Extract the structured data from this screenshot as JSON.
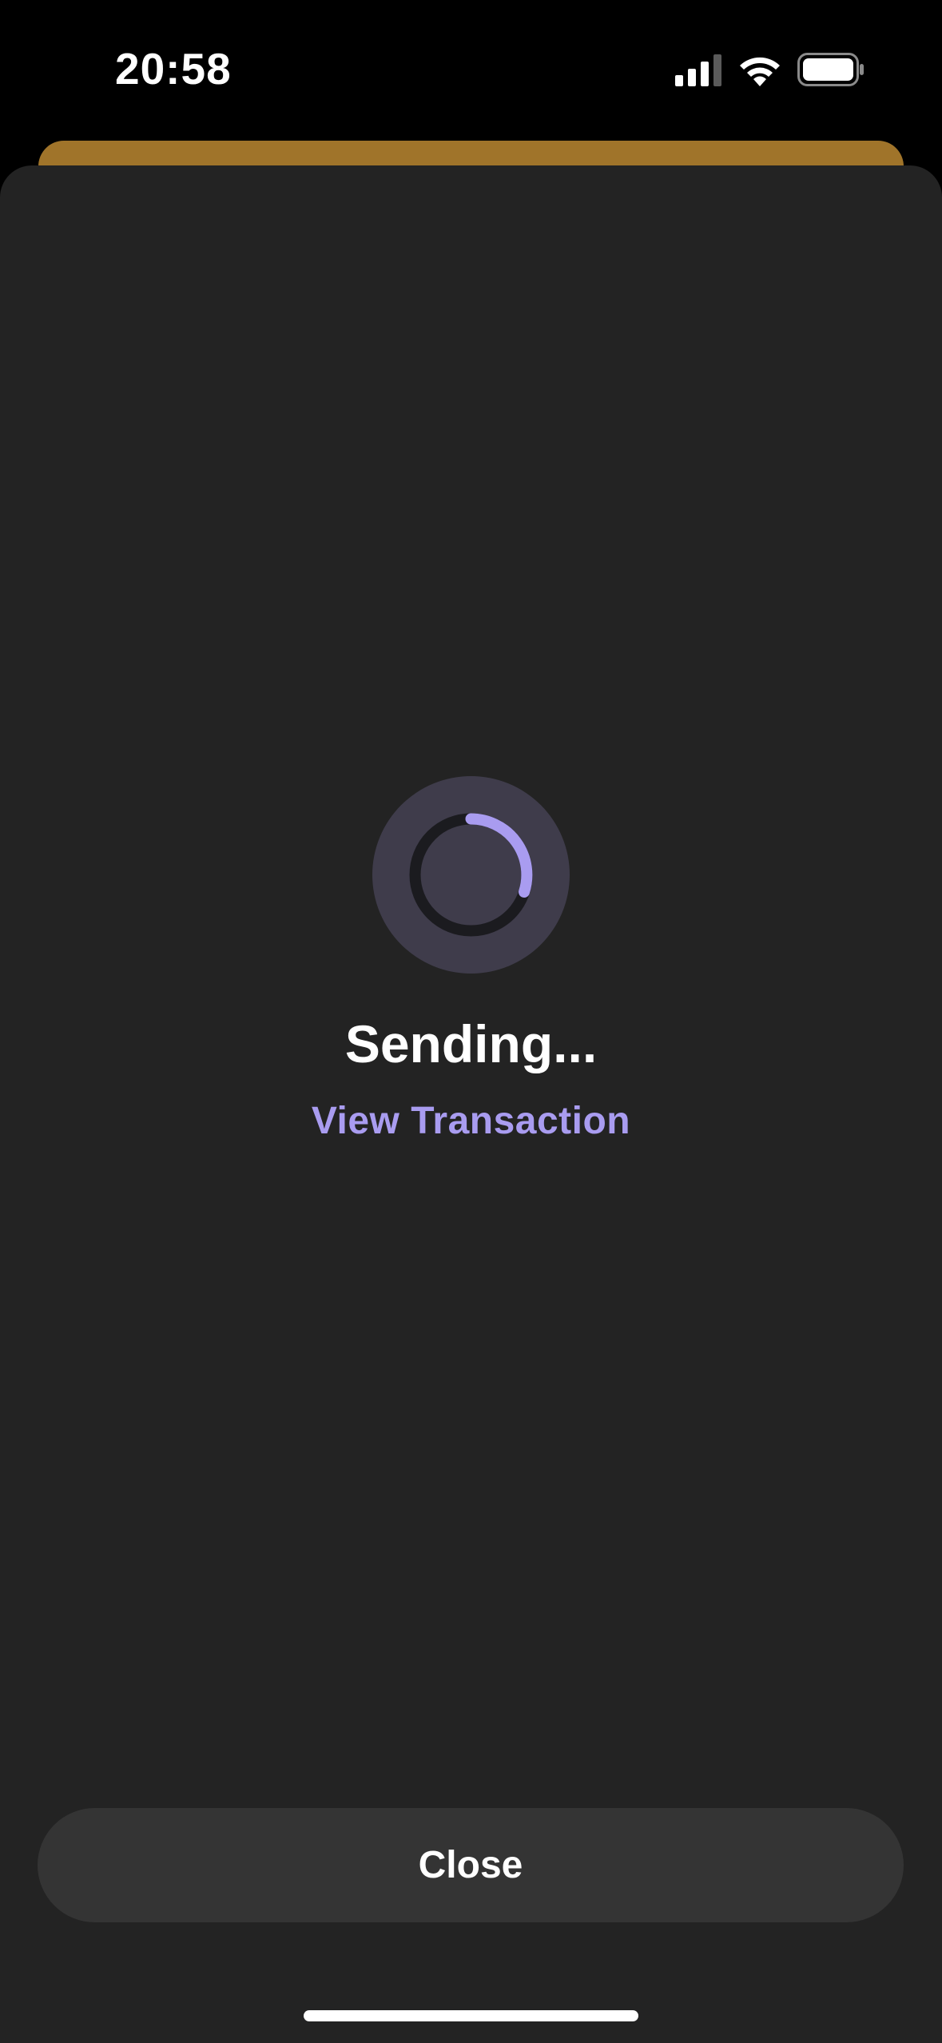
{
  "status_bar": {
    "time": "20:58",
    "icons": [
      "cellular-signal-icon",
      "wifi-icon",
      "battery-icon"
    ]
  },
  "transaction": {
    "status_title": "Sending...",
    "view_link_label": "View Transaction",
    "spinner_icon": "loading-spinner-icon"
  },
  "footer": {
    "close_label": "Close"
  },
  "colors": {
    "accent": "#a99cf0",
    "sheet_background": "#232323",
    "back_card": "#a0742a",
    "button_background": "#343434",
    "spinner_background": "#3f3c4b"
  }
}
